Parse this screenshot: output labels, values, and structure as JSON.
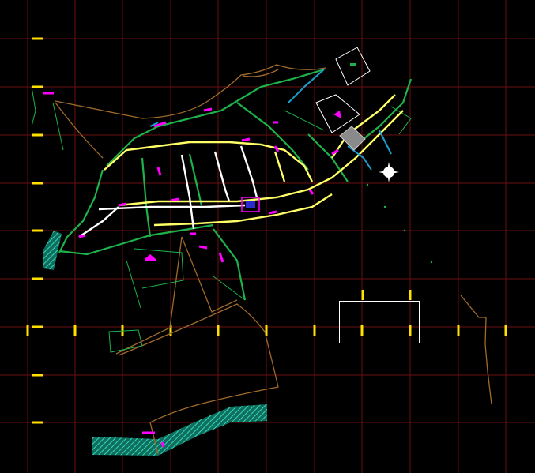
{
  "viewport": {
    "background": "#000000",
    "grid_color": "#6b0f0f"
  },
  "colors": {
    "tick": "#ffe000",
    "road_white": "#ffffff",
    "road_yellow": "#ffff66",
    "road_green": "#1db34a",
    "pipe_magenta": "#ff00ff",
    "contour_brown": "#a06a2a",
    "hatch_cyan": "#20c0a0",
    "water_blue": "#1aa0d0"
  },
  "icons": {
    "north_arrow": "compass-rose-icon",
    "selection": "selection-rectangle"
  }
}
